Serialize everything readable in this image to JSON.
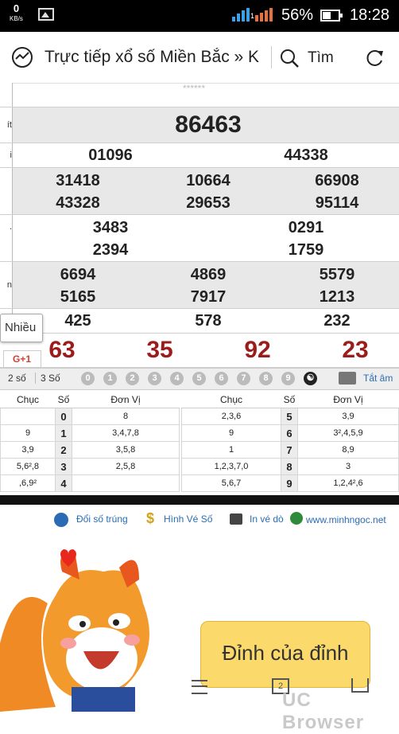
{
  "status": {
    "speed_value": "0",
    "speed_unit": "KB/s",
    "battery": "56%",
    "time": "18:28",
    "sim": "1"
  },
  "address": {
    "page_title": "Trực tiếp xổ số Miền Bắc » K",
    "find_label": "Tìm"
  },
  "results": {
    "top_partial": "******",
    "special": "86463",
    "special_label": "ít",
    "first": [
      "01096",
      "44338"
    ],
    "first_label": "i",
    "third": [
      "31418",
      "10664",
      "66908",
      "43328",
      "29653",
      "95114"
    ],
    "fourth": [
      "3483",
      "0291",
      "2394",
      "1759"
    ],
    "fourth_label": ".",
    "fifth": [
      "6694",
      "4869",
      "5579",
      "5165",
      "7917",
      "1213"
    ],
    "fifth_label": "n",
    "sixth": [
      "425",
      "578",
      "232"
    ],
    "loto": [
      "63",
      "35",
      "92",
      "23"
    ]
  },
  "popup": {
    "label": "Nhiều",
    "gplus": "G+1"
  },
  "controls": {
    "opt2": "2 số",
    "opt3": "3 Số",
    "balls": [
      "0",
      "1",
      "2",
      "3",
      "4",
      "5",
      "6",
      "7",
      "8",
      "9"
    ],
    "mute": "Tắt âm"
  },
  "loto_table": {
    "headers": {
      "chuc": "Chục",
      "so": "Số",
      "donvi": "Đơn Vị"
    },
    "left": [
      {
        "chuc": "",
        "so": "0",
        "donvi": "8"
      },
      {
        "chuc": "9",
        "so": "1",
        "donvi": "3,4,7,8"
      },
      {
        "chuc": "3,9",
        "so": "2",
        "donvi": "3,5,8"
      },
      {
        "chuc": "5,6²,8",
        "so": "3",
        "donvi": "2,5,8"
      },
      {
        "chuc": ",6,9²",
        "so": "4",
        "donvi": ""
      }
    ],
    "right": [
      {
        "chuc": "2,3,6",
        "so": "5",
        "donvi": "3,9"
      },
      {
        "chuc": "9",
        "so": "6",
        "donvi": "3²,4,5,9"
      },
      {
        "chuc": "1",
        "so": "7",
        "donvi": "8,9"
      },
      {
        "chuc": "1,2,3,7,0",
        "so": "8",
        "donvi": "3"
      },
      {
        "chuc": "5,6,7",
        "so": "9",
        "donvi": "1,2,4²,6"
      }
    ]
  },
  "links": {
    "check": "Đổi số trúng",
    "images": "Hình Vé Số",
    "print": "In vé dò",
    "site": "www.minhngoc.net"
  },
  "mascot": {
    "speech": "Đỉnh của đỉnh"
  },
  "brand": "UC Browser",
  "bottom": {
    "tabs": "2"
  },
  "colors": {
    "loto_red": "#9c1b1b",
    "row_gray": "#e8e8e8",
    "link_blue": "#2a6cb3",
    "speech_yellow": "#fbd96a"
  }
}
